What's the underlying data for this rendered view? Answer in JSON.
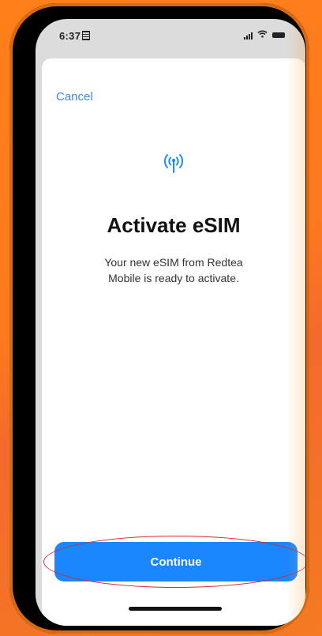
{
  "status_bar": {
    "time": "6:37"
  },
  "sheet": {
    "cancel_label": "Cancel",
    "icon": "antenna-icon",
    "title": "Activate eSIM",
    "subtitle_line1": "Your new eSIM from Redtea",
    "subtitle_line2": "Mobile is ready to activate.",
    "continue_label": "Continue"
  },
  "colors": {
    "accent": "#1a86ff",
    "link": "#3f86e6",
    "background": "#f57a22",
    "annotation_circle": "#d9262a"
  }
}
